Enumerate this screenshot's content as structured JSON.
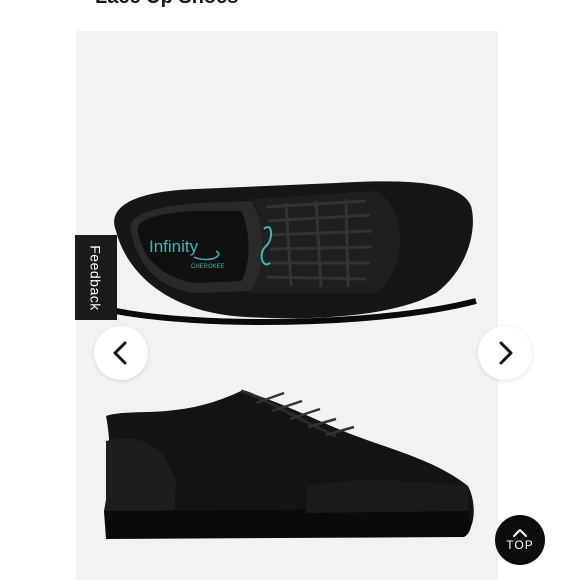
{
  "page": {
    "title": "Lace Up Shoes"
  },
  "gallery": {
    "image_alt": "Black lace up shoes, top and side view",
    "insole_text": "Infinity",
    "insole_subtext": "CHEROKEE",
    "prev_icon": "chevron-left-icon",
    "next_icon": "chevron-right-icon"
  },
  "feedback": {
    "label": "Feedback"
  },
  "scroll_top": {
    "label": "TOP",
    "icon": "arrow-up-icon"
  },
  "colors": {
    "accent_teal": "#3fb8b5",
    "dark": "#1a1a1a",
    "gallery_bg": "#f2f2f2"
  }
}
